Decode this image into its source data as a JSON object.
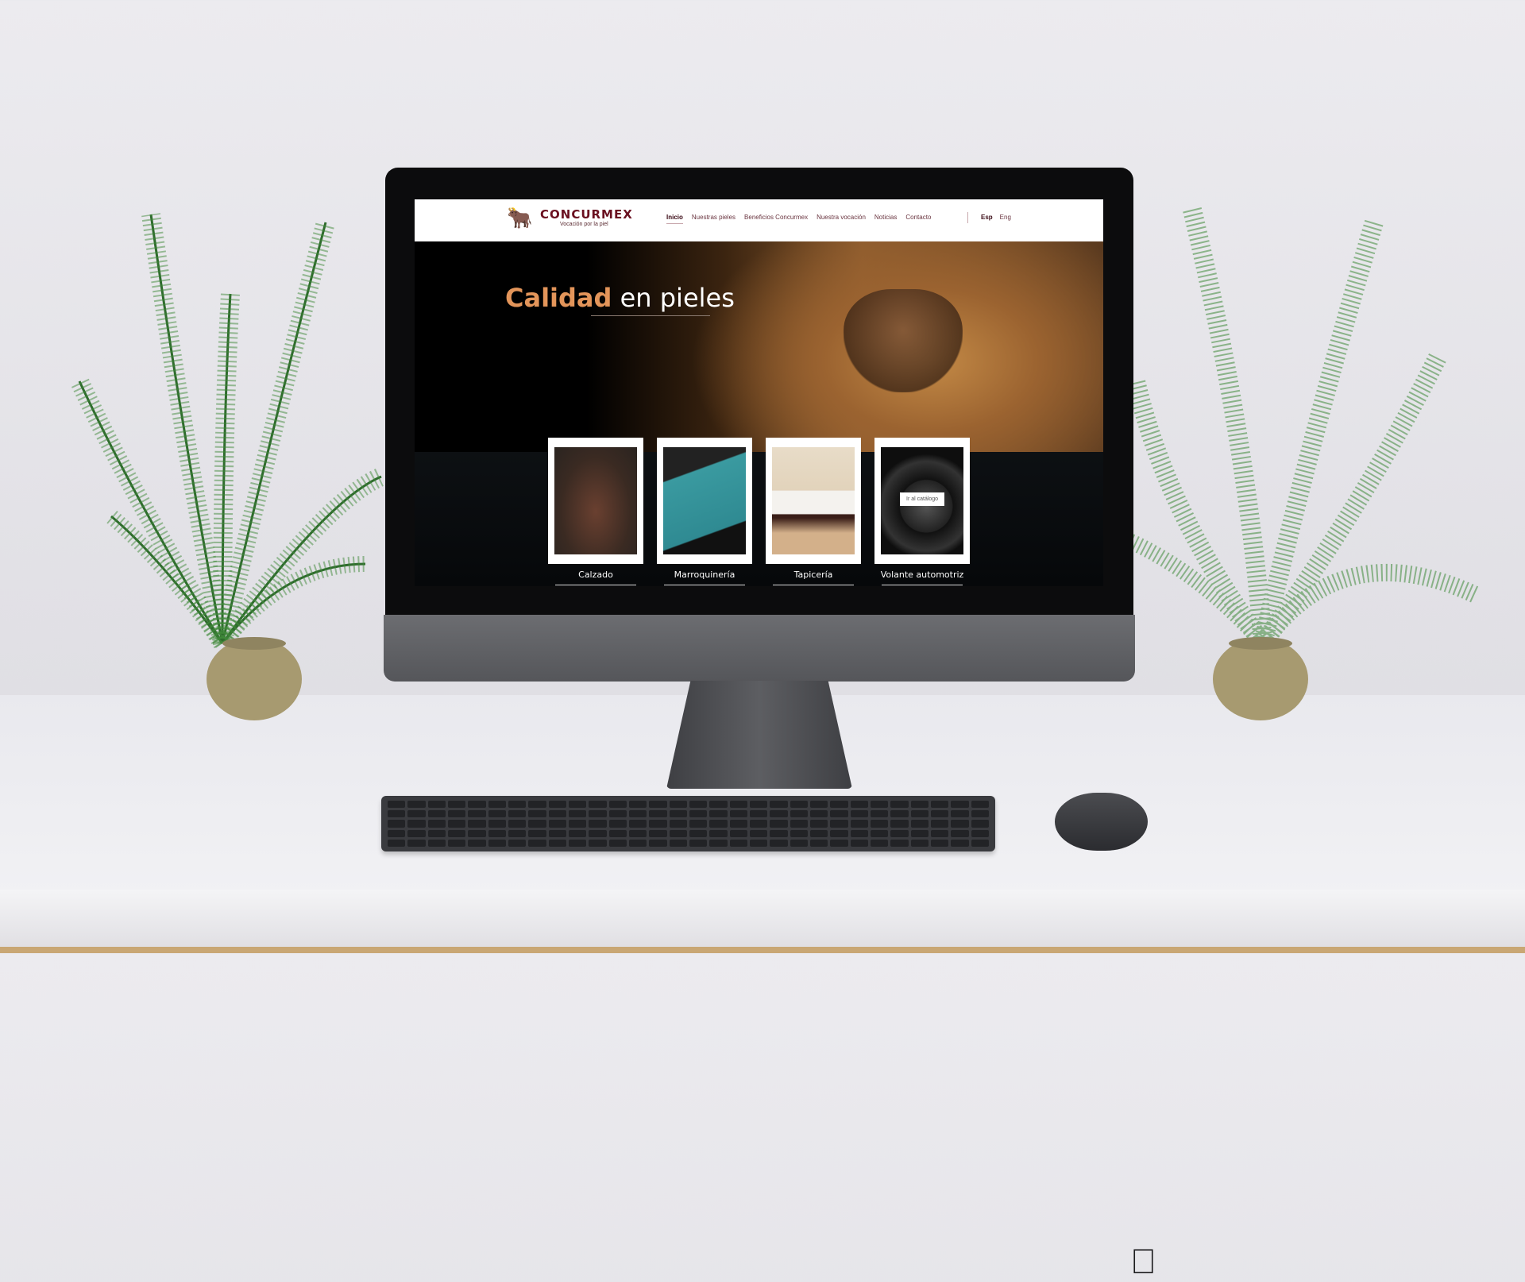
{
  "site": {
    "brand": "CONCURMEX",
    "tagline": "Vocación por la piel",
    "nav": [
      "Inicio",
      "Nuestras pieles",
      "Beneficios Concurmex",
      "Nuestra vocación",
      "Noticias",
      "Contacto"
    ],
    "active_nav": "Inicio",
    "languages": [
      "Esp",
      "Eng"
    ],
    "hero": {
      "title_bold": "Calidad",
      "title_rest": " en pieles"
    },
    "cards": [
      {
        "label": "Calzado"
      },
      {
        "label": "Marroquinería"
      },
      {
        "label": "Tapicería"
      },
      {
        "label": "Volante automotriz",
        "hover_button": "Ir al catálogo"
      }
    ],
    "accent": "#e3955a",
    "brand_color": "#6a1020"
  }
}
